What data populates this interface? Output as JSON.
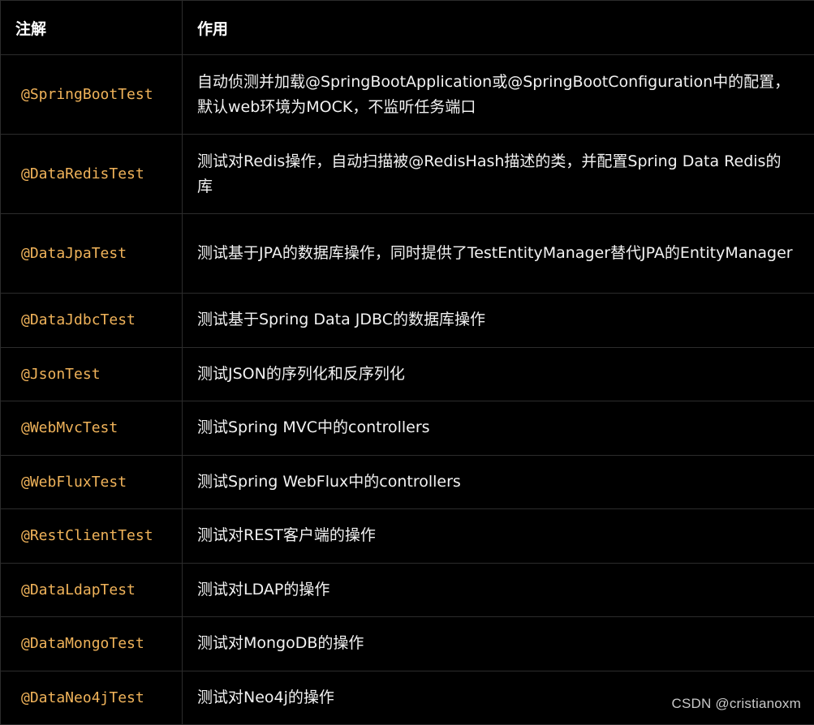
{
  "table": {
    "headers": {
      "annotation": "注解",
      "purpose": "作用"
    },
    "rows": [
      {
        "annotation": "@SpringBootTest",
        "description": "自动侦测并加载@SpringBootApplication或@SpringBootConfiguration中的配置，默认web环境为MOCK，不监听任务端口"
      },
      {
        "annotation": "@DataRedisTest",
        "description": "测试对Redis操作，自动扫描被@RedisHash描述的类，并配置Spring Data Redis的库"
      },
      {
        "annotation": "@DataJpaTest",
        "description": "测试基于JPA的数据库操作，同时提供了TestEntityManager替代JPA的EntityManager"
      },
      {
        "annotation": "@DataJdbcTest",
        "description": "测试基于Spring Data JDBC的数据库操作"
      },
      {
        "annotation": "@JsonTest",
        "description": "测试JSON的序列化和反序列化"
      },
      {
        "annotation": "@WebMvcTest",
        "description": "测试Spring MVC中的controllers"
      },
      {
        "annotation": "@WebFluxTest",
        "description": "测试Spring WebFlux中的controllers"
      },
      {
        "annotation": "@RestClientTest",
        "description": "测试对REST客户端的操作"
      },
      {
        "annotation": "@DataLdapTest",
        "description": "测试对LDAP的操作"
      },
      {
        "annotation": "@DataMongoTest",
        "description": "测试对MongoDB的操作"
      },
      {
        "annotation": "@DataNeo4jTest",
        "description": "测试对Neo4j的操作"
      }
    ]
  },
  "watermark": "CSDN @cristianoxm",
  "colors": {
    "background": "#000000",
    "annotation_text": "#f0b35a",
    "body_text": "#f2f2f2",
    "grid_line": "#2c2c2c"
  }
}
